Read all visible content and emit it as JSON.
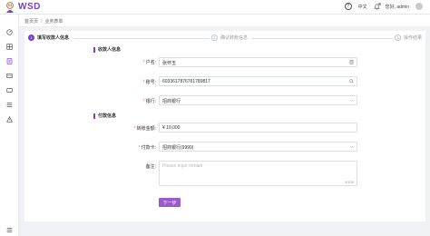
{
  "header": {
    "logo_text": "WSD",
    "language": "中文",
    "greeting": "您好, admin"
  },
  "breadcrumb": {
    "home": "首页页",
    "current": "业务表单"
  },
  "steps": [
    {
      "num": "1",
      "label": "填写收款人信息"
    },
    {
      "num": "2",
      "label": "确认转账信息"
    },
    {
      "num": "3",
      "label": "操作结果"
    }
  ],
  "form": {
    "payee_section": "收款人信息",
    "account_name_label": "户名:",
    "account_name_value": "张怀玉",
    "account_number_label": "账号:",
    "account_number_value": "6033617876761789817",
    "bank_label": "银行:",
    "bank_value": "招商银行",
    "payer_section": "付款信息",
    "amount_label": "转账金额:",
    "amount_value": "¥ 10,000",
    "card_label": "付款卡:",
    "card_value": "招商银行(9999)",
    "remark_label": "备注:",
    "remark_placeholder": "Please input remark",
    "remark_count": "0/100",
    "next_button": "下一步"
  }
}
